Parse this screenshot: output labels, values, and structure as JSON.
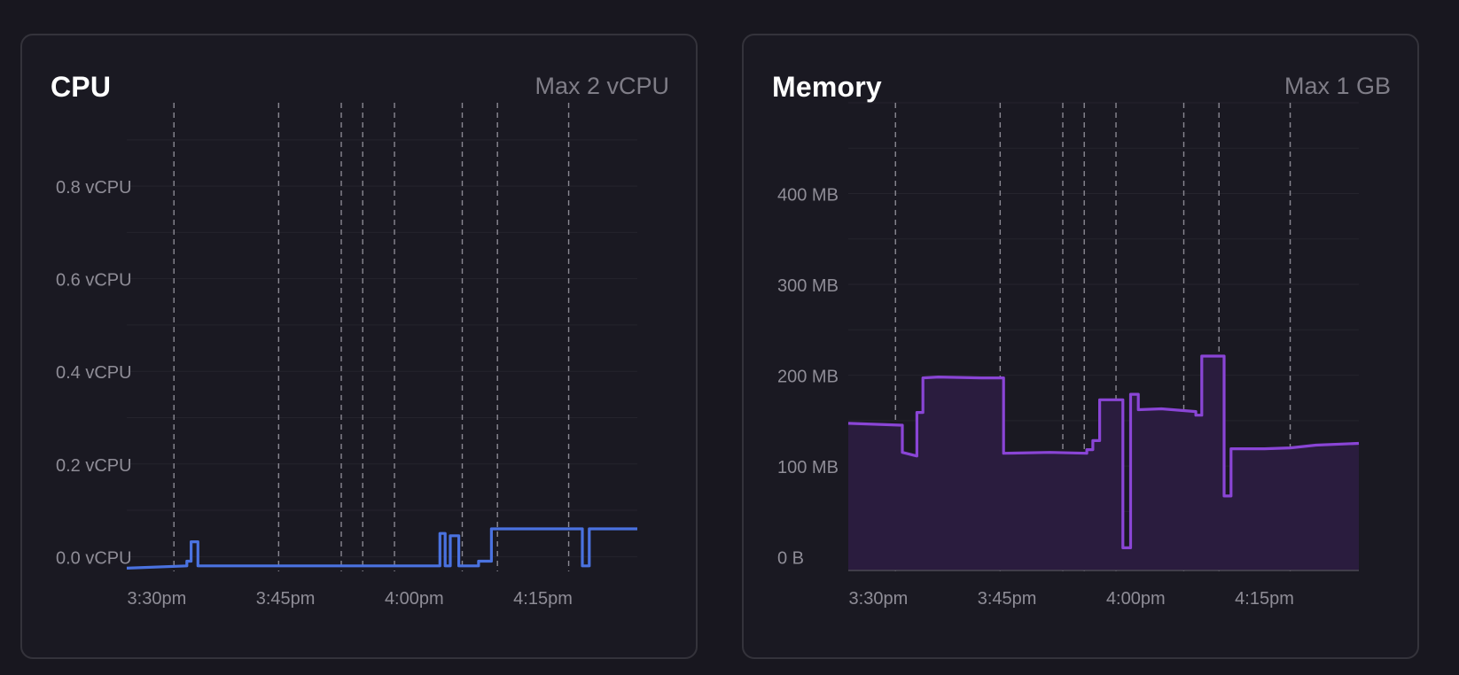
{
  "panels": [
    {
      "id": "cpu",
      "title": "CPU",
      "max_label": "Max 2 vCPU",
      "color": "#4a72e0",
      "fill": false
    },
    {
      "id": "mem",
      "title": "Memory",
      "max_label": "Max 1 GB",
      "color": "#8a45d6",
      "fill": true,
      "fill_color": "#2a1c3e"
    }
  ],
  "chart_data": [
    {
      "type": "line",
      "title": "CPU",
      "subtitle": "Max 2 vCPU",
      "x_ticks": [
        "3:30pm",
        "3:45pm",
        "4:00pm",
        "4:15pm"
      ],
      "x_tick_minutes": [
        0,
        15,
        30,
        45
      ],
      "xlim_minutes": [
        -3.5,
        56
      ],
      "y_ticks": [
        0,
        0.2,
        0.4,
        0.6,
        0.8
      ],
      "y_tick_labels": [
        "0.0 vCPU",
        "0.2 vCPU",
        "0.4 vCPU",
        "0.6 vCPU",
        "0.8 vCPU"
      ],
      "ylim": [
        -0.03,
        0.98
      ],
      "event_markers_minutes": [
        2,
        14.2,
        21.5,
        24,
        27.7,
        35.6,
        39.7,
        48
      ],
      "series": [
        {
          "x_minutes": [
            -3.5,
            3.5,
            3.5,
            4,
            4,
            4.8,
            4.8,
            33,
            33,
            33.6,
            33.6,
            34.2,
            34.2,
            35.2,
            35.2,
            37.5,
            37.5,
            39,
            39,
            49.6,
            49.6,
            50.4,
            50.4,
            56
          ],
          "y": [
            -0.025,
            -0.02,
            -0.01,
            -0.01,
            0.032,
            0.032,
            -0.02,
            -0.02,
            0.05,
            0.05,
            -0.02,
            -0.02,
            0.045,
            0.045,
            -0.02,
            -0.02,
            -0.01,
            -0.01,
            0.06,
            0.06,
            -0.02,
            -0.02,
            0.06,
            0.06
          ],
          "step_note": ""
        }
      ]
    },
    {
      "type": "area",
      "title": "Memory",
      "subtitle": "Max 1 GB",
      "x_ticks": [
        "3:30pm",
        "3:45pm",
        "4:00pm",
        "4:15pm"
      ],
      "x_tick_minutes": [
        0,
        15,
        30,
        45
      ],
      "xlim_minutes": [
        -3.5,
        56
      ],
      "y_ticks": [
        0,
        100,
        200,
        300,
        400
      ],
      "y_tick_labels": [
        "0 B",
        "100 MB",
        "200 MB",
        "300 MB",
        "400 MB"
      ],
      "ylim": [
        -15,
        500
      ],
      "y_unit": "MB",
      "event_markers_minutes": [
        2,
        14.2,
        21.5,
        24,
        27.7,
        35.6,
        39.7,
        48
      ],
      "series": [
        {
          "x_minutes": [],
          "y": []
        }
      ]
    }
  ]
}
